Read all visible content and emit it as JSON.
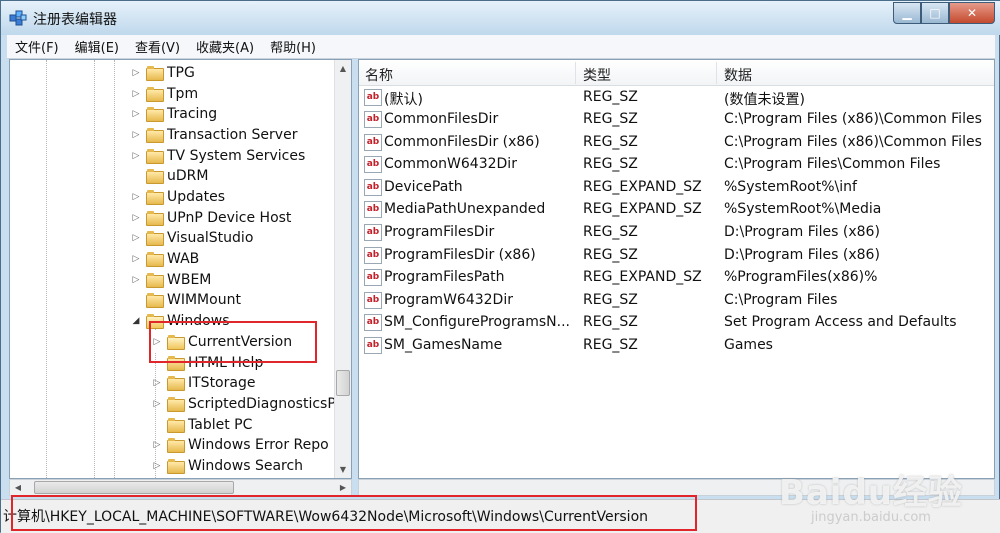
{
  "window": {
    "title": "注册表编辑器",
    "buttons": {
      "minimize": "▁",
      "maximize": "□",
      "close": "✕"
    }
  },
  "menu": [
    "文件(F)",
    "编辑(E)",
    "查看(V)",
    "收藏夹(A)",
    "帮助(H)"
  ],
  "tree": {
    "items": [
      {
        "label": "TPG"
      },
      {
        "label": "Tpm"
      },
      {
        "label": "Tracing"
      },
      {
        "label": "Transaction Server"
      },
      {
        "label": "TV System Services"
      },
      {
        "label": "uDRM"
      },
      {
        "label": "Updates"
      },
      {
        "label": "UPnP Device Host"
      },
      {
        "label": "VisualStudio"
      },
      {
        "label": "WAB"
      },
      {
        "label": "WBEM"
      },
      {
        "label": "WIMMount"
      },
      {
        "label": "Windows"
      },
      {
        "label": "CurrentVersion"
      },
      {
        "label": "HTML Help"
      },
      {
        "label": "ITStorage"
      },
      {
        "label": "ScriptedDiagnosticsP"
      },
      {
        "label": "Tablet PC"
      },
      {
        "label": "Windows Error Repo"
      },
      {
        "label": "Windows Search"
      }
    ]
  },
  "list": {
    "columns": [
      "名称",
      "类型",
      "数据"
    ],
    "rows": [
      {
        "name": "(默认)",
        "type": "REG_SZ",
        "data": "(数值未设置)"
      },
      {
        "name": "CommonFilesDir",
        "type": "REG_SZ",
        "data": "C:\\Program Files (x86)\\Common Files"
      },
      {
        "name": "CommonFilesDir (x86)",
        "type": "REG_SZ",
        "data": "C:\\Program Files (x86)\\Common Files"
      },
      {
        "name": "CommonW6432Dir",
        "type": "REG_SZ",
        "data": "C:\\Program Files\\Common Files"
      },
      {
        "name": "DevicePath",
        "type": "REG_EXPAND_SZ",
        "data": "%SystemRoot%\\inf"
      },
      {
        "name": "MediaPathUnexpanded",
        "type": "REG_EXPAND_SZ",
        "data": "%SystemRoot%\\Media"
      },
      {
        "name": "ProgramFilesDir",
        "type": "REG_SZ",
        "data": "D:\\Program Files (x86)"
      },
      {
        "name": "ProgramFilesDir (x86)",
        "type": "REG_SZ",
        "data": "D:\\Program Files (x86)"
      },
      {
        "name": "ProgramFilesPath",
        "type": "REG_EXPAND_SZ",
        "data": "%ProgramFiles(x86)%"
      },
      {
        "name": "ProgramW6432Dir",
        "type": "REG_SZ",
        "data": "C:\\Program Files"
      },
      {
        "name": "SM_ConfigureProgramsN...",
        "type": "REG_SZ",
        "data": "Set Program Access and Defaults"
      },
      {
        "name": "SM_GamesName",
        "type": "REG_SZ",
        "data": "Games"
      }
    ],
    "value_icon": "ab"
  },
  "status": {
    "path": "计算机\\HKEY_LOCAL_MACHINE\\SOFTWARE\\Wow6432Node\\Microsoft\\Windows\\CurrentVersion"
  },
  "watermark": {
    "logo": "Baidu经验",
    "url": "jingyan.baidu.com"
  },
  "colors": {
    "highlight_box": "#e0262b",
    "value_icon": "#c4202a"
  }
}
